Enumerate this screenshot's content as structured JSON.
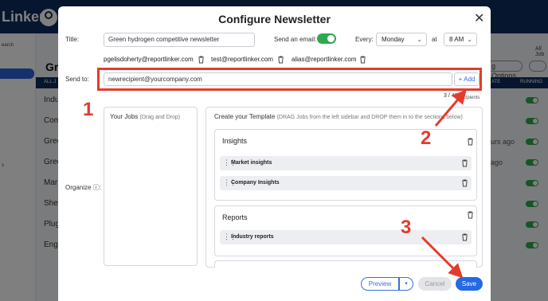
{
  "background": {
    "logo": "Linker",
    "sidebar_text": "earch",
    "sidebar_text2": "s",
    "page_title": "Gre",
    "header_col1": "ALL J",
    "header_col2": "ATE",
    "header_col3": "RUNNING",
    "rows": [
      "Indu",
      "Com",
      "Gree",
      "Gree",
      "Mar",
      "Shel",
      "Plug",
      "Engi"
    ],
    "ago_1": "urs ago",
    "ago_2": "ago",
    "options_button": "g Options",
    "all_jobs": "All Job"
  },
  "modal": {
    "title": "Configure Newsletter",
    "title_label": "Title:",
    "title_value": "Green hydrogen competitive newsletter",
    "send_email_label": "Send an email:",
    "send_email_enabled": true,
    "every_label": "Every:",
    "day": "Monday",
    "at_label": "at",
    "time": "8 AM",
    "recipients": [
      "pgelisdoherty@reportlinker.com",
      "test@reportlinker.com",
      "alias@reportlinker.com"
    ],
    "send_to_label": "Send to:",
    "send_to_value": "newrecipient@yourcompany.com",
    "add_button": "+ Add",
    "recipient_count": "3 / 40",
    "recipient_count_suffix": "cipients",
    "organize_label": "Organize ⓘ:",
    "your_jobs_title": "Your Jobs",
    "your_jobs_hint": "(Drag and Drop)",
    "template_title": "Create your Template",
    "template_hint": "(DRAG Jobs from the left sidebar and DROP them in to the sections below)",
    "sections": [
      {
        "name": "Insights",
        "jobs": [
          "Market insights",
          "Company Insights"
        ]
      },
      {
        "name": "Reports",
        "jobs": [
          "Industry reports"
        ]
      }
    ],
    "preview_button": "Preview",
    "preview_caret": "▾",
    "cancel_button": "Cancel",
    "save_button": "Save"
  },
  "annotations": {
    "step1": "1",
    "step2": "2",
    "step3": "3",
    "color": "#e53b2c"
  }
}
